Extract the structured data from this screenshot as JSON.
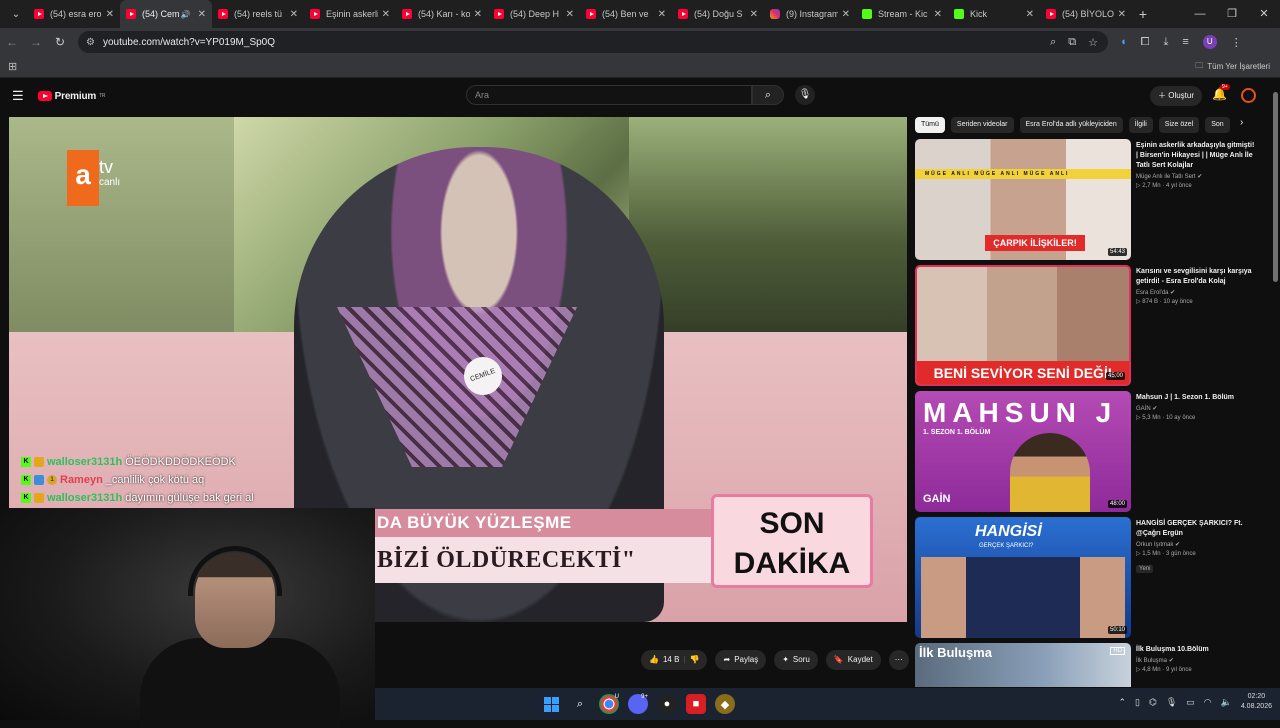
{
  "browser": {
    "tabs": [
      {
        "title": "(54) esra ero",
        "icon": "youtube",
        "active": false
      },
      {
        "title": "(54) Cem",
        "icon": "youtube",
        "active": true,
        "audio": true
      },
      {
        "title": "(54) reels tü",
        "icon": "youtube"
      },
      {
        "title": "Eşinin askerli",
        "icon": "youtube"
      },
      {
        "title": "(54) Karı - ko",
        "icon": "youtube"
      },
      {
        "title": "(54) Deep H",
        "icon": "youtube"
      },
      {
        "title": "(54) Ben ve",
        "icon": "youtube"
      },
      {
        "title": "(54) Doğu S",
        "icon": "youtube"
      },
      {
        "title": "(9) Instagram",
        "icon": "instagram"
      },
      {
        "title": "Stream - Kic",
        "icon": "kick"
      },
      {
        "title": "Kick",
        "icon": "kick"
      },
      {
        "title": "(54) BİYOLO",
        "icon": "youtube"
      }
    ],
    "new_tab": "+",
    "url": "youtube.com/watch?v=YP019M_Sp0Q",
    "bookmarks_folder": "Tüm Yer İşaretleri",
    "profile_initial": "U"
  },
  "youtube": {
    "logo_text": "Premium",
    "logo_region": "TR",
    "search_placeholder": "Ara",
    "create_label": "Oluştur",
    "notifications_badge": "9+",
    "actions": {
      "likes": "14 B",
      "share": "Paylaş",
      "ask": "Soru",
      "save": "Kaydet"
    },
    "filters": [
      "Tümü",
      "Seriden videolar",
      "Esra Erol'da adlı yükleyiciden",
      "İlgili",
      "Size özel",
      "Son"
    ],
    "recommendations": [
      {
        "title": "Eşinin askerlik arkadaşıyla gitmişti! | Birsen'in Hikayesi | | Müge Anlı İle Tatlı Sert Kolajlar",
        "channel": "Müge Anlı ile Tatlı Sert",
        "views": "2,7 Mn",
        "age": "4 yıl önce",
        "duration": "54:43",
        "thumb_text": "ÇARPIK İLİŞKİLER!",
        "thumb_band": "MÜGE ANLI   MÜGE ANLI   MÜGE ANLI"
      },
      {
        "title": "Karısını ve sevgilisini karşı karşıya getirdi! - Esra Erol'da Kolaj",
        "channel": "Esra Erol'da",
        "views": "874 B",
        "age": "10 ay önce",
        "duration": "45:00",
        "thumb_text": "BENİ SEVİYOR SENİ DEĞİL"
      },
      {
        "title": "Mahsun J | 1. Sezon 1. Bölüm",
        "channel": "GAİN",
        "views": "5,3 Mn",
        "age": "10 ay önce",
        "duration": "48:00",
        "thumb_text": "MAHSUN J",
        "thumb_sub": "1. SEZON 1. BÖLÜM",
        "thumb_brand": "GAİN"
      },
      {
        "title": "HANGİSİ GERÇEK ŞARKICI? Ft. @Çağrı Ergün",
        "channel": "Orkun Işıtmak",
        "views": "1,5 Mn",
        "age": "3 gün önce",
        "duration": "50:10",
        "badge": "Yeni",
        "thumb_text": "HANGİSİ",
        "thumb_sub": "GERÇEK ŞARKICI?"
      },
      {
        "title": "İlk Buluşma 10.Bölüm",
        "channel": "İlk Buluşma",
        "views": "4,8 Mn",
        "age": "9 yıl önce",
        "thumb_text": "İlk Buluşma",
        "thumb_hd": "HD"
      }
    ]
  },
  "video": {
    "channel_logo": "a",
    "channel_logo_text": "tv",
    "channel_logo_sub": "canlı",
    "name_badge": "CEMİLE",
    "lower_third_line1": "DA BÜYÜK YÜZLEŞME",
    "lower_third_line2": "BİZİ ÖLDÜRECEKTİ\"",
    "son_dakika": "SON DAKİKA"
  },
  "chat": [
    {
      "user": "walloser3131h",
      "message": "ÖEÖDKDDÖDKEÖDK",
      "color": "#2ec05a"
    },
    {
      "user": "Rameyn",
      "message": "_canlilik çok kötü aq",
      "color": "#e03f4f",
      "tier": "1"
    },
    {
      "user": "walloser3131h",
      "message": "dayımın gülüşe bak geri al",
      "color": "#2ec05a"
    }
  ],
  "taskbar": {
    "time": "02:20",
    "date": "4.08.2026",
    "chrome_badge": "U",
    "discord_badge": "9+"
  }
}
